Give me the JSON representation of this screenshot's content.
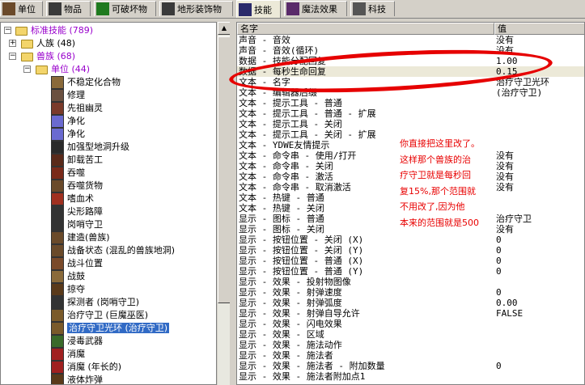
{
  "tabs": [
    {
      "label": "单位",
      "icon": "unit-icon",
      "color": "#6b4a2a"
    },
    {
      "label": "物品",
      "icon": "item-icon",
      "color": "#3a3a3a"
    },
    {
      "label": "可破坏物",
      "icon": "tree-icon",
      "color": "#1f7a1f"
    },
    {
      "label": "地形装饰物",
      "icon": "doodad-icon",
      "color": "#3a3a3a"
    },
    {
      "label": "技能",
      "icon": "ability-icon",
      "color": "#2a2a6a"
    },
    {
      "label": "魔法效果",
      "icon": "buff-icon",
      "color": "#5a2a6a"
    },
    {
      "label": "科技",
      "icon": "upgrade-icon",
      "color": "#555555"
    }
  ],
  "tree": {
    "root": "标准技能 (789)",
    "human": "人族 (48)",
    "orc": "兽族 (68)",
    "units": "单位 (44)",
    "items": [
      {
        "label": "不稳定化合物",
        "color": "#8a6a3a"
      },
      {
        "label": "修理",
        "color": "#6a5040"
      },
      {
        "label": "先祖幽灵",
        "color": "#7a3a2a"
      },
      {
        "label": "净化",
        "color": "#6a6ad0"
      },
      {
        "label": "净化",
        "color": "#6a6ad0"
      },
      {
        "label": "加强型地洞升级",
        "color": "#2a2a2a"
      },
      {
        "label": "卸载苦工",
        "color": "#5a2a1a"
      },
      {
        "label": "吞噬",
        "color": "#7a2a1a"
      },
      {
        "label": "吞噬货物",
        "color": "#6a4a2a"
      },
      {
        "label": "嗜血术",
        "color": "#a03020"
      },
      {
        "label": "尖形路障",
        "color": "#333333"
      },
      {
        "label": "岗哨守卫",
        "color": "#333333"
      },
      {
        "label": "建造(兽族)",
        "color": "#6a4a2a"
      },
      {
        "label": "战备状态 (混乱的兽族地洞)",
        "color": "#6a4a2a"
      },
      {
        "label": "战斗位置",
        "color": "#7a4a2a"
      },
      {
        "label": "战鼓",
        "color": "#8a6a3a"
      },
      {
        "label": "掠夺",
        "color": "#5a3a1a"
      },
      {
        "label": "探测者 (岗哨守卫)",
        "color": "#333333"
      },
      {
        "label": "治疗守卫 (巨魔巫医)",
        "color": "#7a5a2a"
      },
      {
        "label": "治疗守卫光环 (治疗守卫)",
        "color": "#7a5a2a",
        "selected": true
      },
      {
        "label": "浸毒武器",
        "color": "#3a6a2a"
      },
      {
        "label": "消魔",
        "color": "#a02020"
      },
      {
        "label": "消魔 (年长的)",
        "color": "#a02020"
      },
      {
        "label": "液体炸弹",
        "color": "#5a3a1a"
      }
    ]
  },
  "table": {
    "col_name": "名字",
    "col_value": "值",
    "rows": [
      {
        "name": "声音 - 音效",
        "value": "没有"
      },
      {
        "name": "声音 - 音效(循环)",
        "value": "没有"
      },
      {
        "name": "数据 - 技能分配回复",
        "value": "1.00"
      },
      {
        "name": "数据 - 每秒生命回复",
        "value": "0.15",
        "highlight": true
      },
      {
        "name": "文本 - 名字",
        "value": "治疗守卫光环"
      },
      {
        "name": "文本 - 编辑器后缀",
        "value": "(治疗守卫)"
      },
      {
        "name": "文本 - 提示工具 - 普通",
        "value": ""
      },
      {
        "name": "文本 - 提示工具 - 普通 - 扩展",
        "value": ""
      },
      {
        "name": "文本 - 提示工具 - 关闭",
        "value": ""
      },
      {
        "name": "文本 - 提示工具 - 关闭 - 扩展",
        "value": ""
      },
      {
        "name": "文本 - YDWE友情提示",
        "value": ""
      },
      {
        "name": "文本 - 命令串 - 使用/打开",
        "value": "没有"
      },
      {
        "name": "文本 - 命令串 - 关闭",
        "value": "没有"
      },
      {
        "name": "文本 - 命令串 - 激活",
        "value": "没有"
      },
      {
        "name": "文本 - 命令串 - 取消激活",
        "value": "没有"
      },
      {
        "name": "文本 - 热键 - 普通",
        "value": ""
      },
      {
        "name": "文本 - 热键 - 关闭",
        "value": ""
      },
      {
        "name": "显示 - 图标 - 普通",
        "value": "治疗守卫"
      },
      {
        "name": "显示 - 图标 - 关闭",
        "value": "没有"
      },
      {
        "name": "显示 - 按钮位置 - 关闭 (X)",
        "value": "0"
      },
      {
        "name": "显示 - 按钮位置 - 关闭 (Y)",
        "value": "0"
      },
      {
        "name": "显示 - 按钮位置 - 普通 (X)",
        "value": "0"
      },
      {
        "name": "显示 - 按钮位置 - 普通 (Y)",
        "value": "0"
      },
      {
        "name": "显示 - 效果 - 投射物图像",
        "value": ""
      },
      {
        "name": "显示 - 效果 - 射弹速度",
        "value": "0"
      },
      {
        "name": "显示 - 效果 - 射弹弧度",
        "value": "0.00"
      },
      {
        "name": "显示 - 效果 - 射弹自导允许",
        "value": "FALSE"
      },
      {
        "name": "显示 - 效果 - 闪电效果",
        "value": ""
      },
      {
        "name": "显示 - 效果 - 区域",
        "value": ""
      },
      {
        "name": "显示 - 效果 - 施法动作",
        "value": ""
      },
      {
        "name": "显示 - 效果 - 施法者",
        "value": ""
      },
      {
        "name": "显示 - 效果 - 施法者 - 附加数量",
        "value": "0"
      },
      {
        "name": "显示 - 效果 - 施法者附加点1",
        "value": ""
      }
    ]
  },
  "annotation": {
    "lines": [
      "你直接把这里改了。",
      "这样那个兽族的治",
      "疗守卫就是每秒回",
      "复15%,那个范围就",
      "不用改了,因为他",
      "本来的范围就是500"
    ],
    "color": "#e80000"
  }
}
